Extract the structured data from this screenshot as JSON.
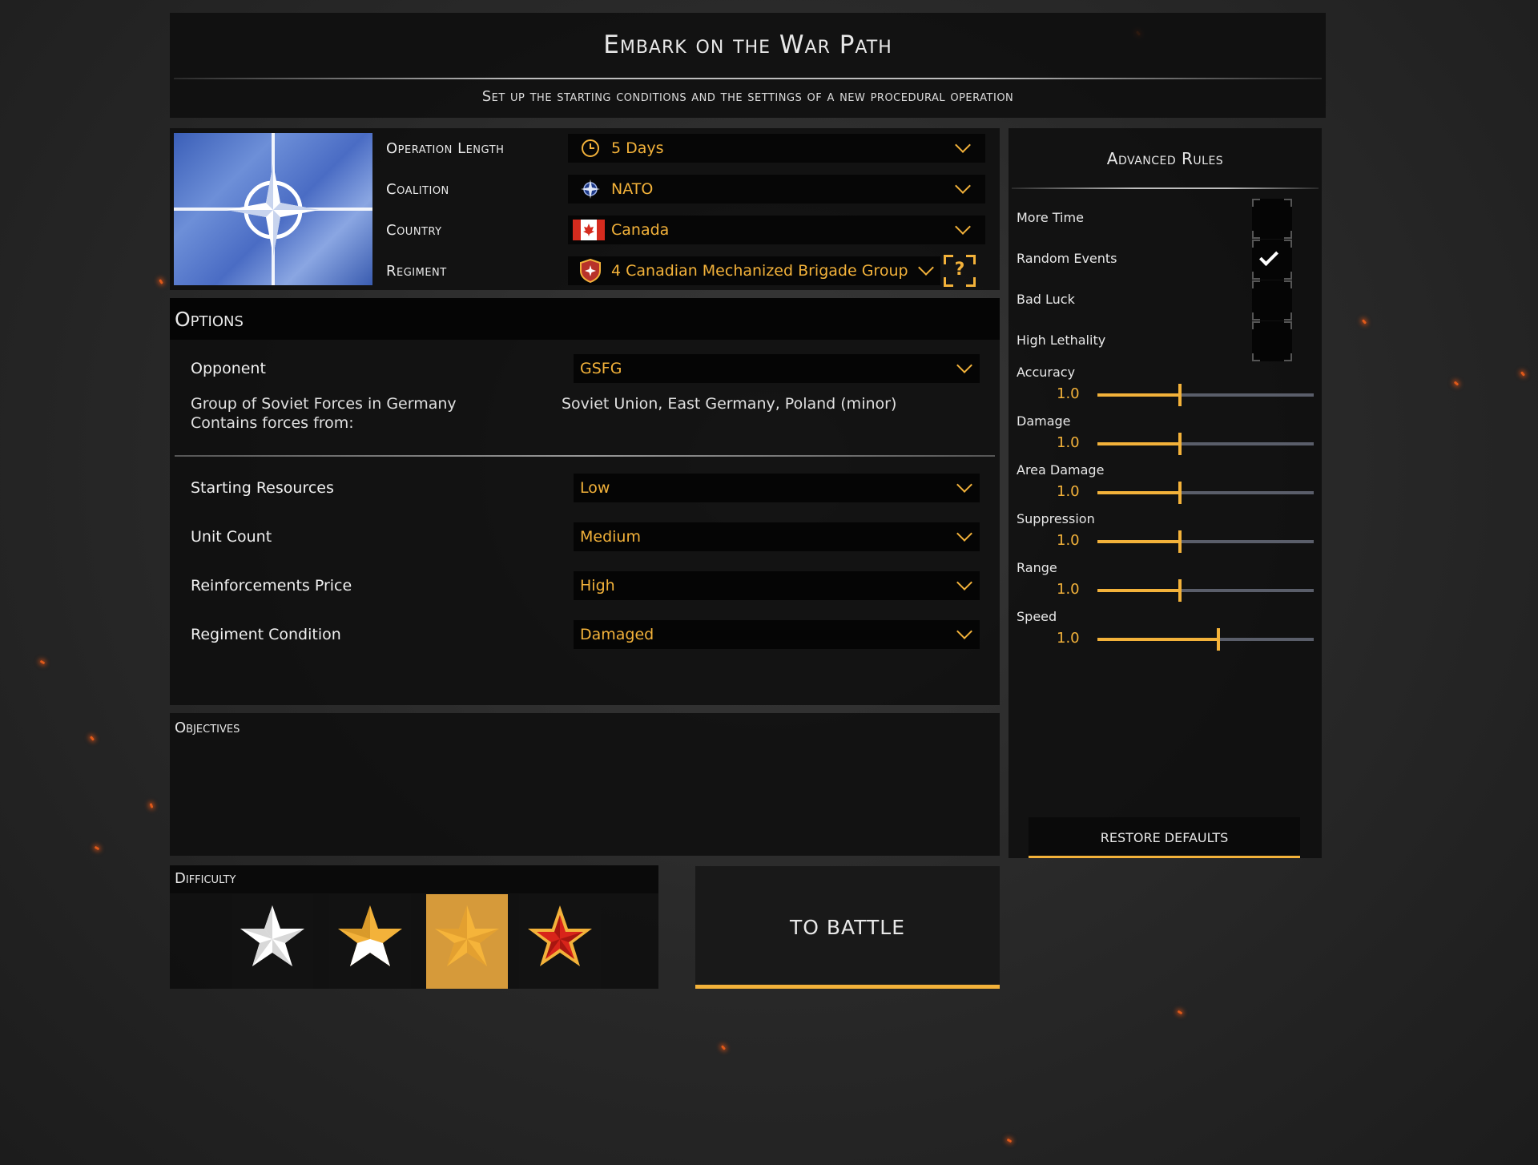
{
  "header": {
    "title": "Embark on the War Path",
    "subtitle": "Set up the starting conditions and the settings of a new procedural operation"
  },
  "config": {
    "flag_icon": "nato-flag",
    "operation_length": {
      "label": "Operation Length",
      "value": "5 Days",
      "icon": "clock-icon"
    },
    "coalition": {
      "label": "Coalition",
      "value": "NATO",
      "icon": "nato-emblem-icon"
    },
    "country": {
      "label": "Country",
      "value": "Canada",
      "icon": "canada-flag-icon"
    },
    "regiment": {
      "label": "Regiment",
      "value": "4 Canadian Mechanized Brigade Group",
      "icon": "regiment-shield-icon",
      "help": "?"
    }
  },
  "options": {
    "title": "Options",
    "opponent": {
      "label": "Opponent",
      "value": "GSFG"
    },
    "opponent_name": "Group of Soviet Forces in Germany",
    "contains_label": "Contains forces from:",
    "contains_value": "Soviet Union, East Germany, Poland (minor)",
    "starting_resources": {
      "label": "Starting Resources",
      "value": "Low"
    },
    "unit_count": {
      "label": "Unit Count",
      "value": "Medium"
    },
    "reinforcements_price": {
      "label": "Reinforcements Price",
      "value": "High"
    },
    "regiment_condition": {
      "label": "Regiment Condition",
      "value": "Damaged"
    }
  },
  "objectives": {
    "title": "Objectives"
  },
  "difficulty": {
    "title": "Difficulty",
    "levels": [
      "white-star",
      "half-gold-star",
      "gold-star",
      "red-star"
    ],
    "selected_index": 2
  },
  "battle": {
    "label": "TO BATTLE"
  },
  "advanced": {
    "title": "Advanced Rules",
    "toggles": [
      {
        "label": "More Time",
        "checked": false
      },
      {
        "label": "Random Events",
        "checked": true
      },
      {
        "label": "Bad Luck",
        "checked": false
      },
      {
        "label": "High Lethality",
        "checked": false
      }
    ],
    "sliders": [
      {
        "label": "Accuracy",
        "value": "1.0",
        "fraction": 0.38
      },
      {
        "label": "Damage",
        "value": "1.0",
        "fraction": 0.38
      },
      {
        "label": "Area Damage",
        "value": "1.0",
        "fraction": 0.38
      },
      {
        "label": "Suppression",
        "value": "1.0",
        "fraction": 0.38
      },
      {
        "label": "Range",
        "value": "1.0",
        "fraction": 0.38
      },
      {
        "label": "Speed",
        "value": "1.0",
        "fraction": 0.56
      }
    ],
    "restore_label": "RESTORE DEFAULTS"
  },
  "colors": {
    "accent": "#f3b23a",
    "panel": "#0e0e0e",
    "ember": "#e05a1a"
  }
}
